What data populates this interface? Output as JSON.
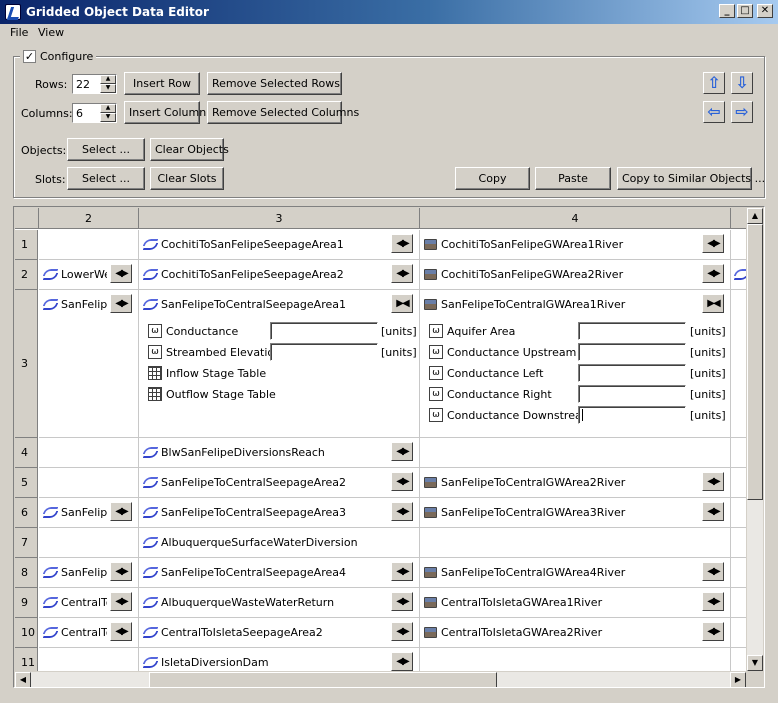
{
  "window": {
    "title": "Gridded Object Data Editor",
    "minimize": "_",
    "maximize": "□",
    "close": "✕"
  },
  "menu": [
    "File",
    "View"
  ],
  "configure": {
    "label": "Configure",
    "checked": true,
    "check_mark": "✓",
    "rows_label": "Rows:",
    "rows_value": "22",
    "columns_label": "Columns:",
    "columns_value": "6",
    "insert_row": "Insert Row",
    "remove_rows": "Remove Selected Rows",
    "insert_column": "Insert Column",
    "remove_columns": "Remove Selected Columns",
    "objects_label": "Objects:",
    "objects_select": "Select ...",
    "clear_objects": "Clear Objects",
    "slots_label": "Slots:",
    "slots_select": "Select ...",
    "clear_slots": "Clear Slots",
    "copy": "Copy",
    "paste": "Paste",
    "copy_similar": "Copy to Similar Objects ...",
    "nav_arrows": [
      "up-arrow-icon",
      "down-arrow-icon",
      "left-arrow-icon",
      "right-arrow-icon"
    ]
  },
  "grid": {
    "columns": [
      "2",
      "3",
      "4"
    ],
    "rows": [
      "1",
      "2",
      "3",
      "4",
      "5",
      "6",
      "7",
      "8",
      "9",
      "10",
      "11"
    ],
    "col2": {
      "r2": "LowerWest",
      "r3": "SanFelipe",
      "r6": "SanFelipe",
      "r8": "SanFelipe",
      "r9": "CentralTo",
      "r10": "CentralTo"
    },
    "col3": {
      "r1": "CochitiToSanFelipeSeepageArea1",
      "r2": "CochitiToSanFelipeSeepageArea2",
      "r3": "SanFelipeToCentralSeepageArea1",
      "r4": "BlwSanFelipeDiversionsReach",
      "r5": "SanFelipeToCentralSeepageArea2",
      "r6": "SanFelipeToCentralSeepageArea3",
      "r7": "AlbuquerqueSurfaceWaterDiversion",
      "r8": "SanFelipeToCentralSeepageArea4",
      "r9": "AlbuquerqueWasteWaterReturn",
      "r10": "CentralToIsletaSeepageArea2",
      "r11": "IsletaDiversionDam"
    },
    "col4": {
      "r1": "CochitiToSanFelipeGWArea1River",
      "r2": "CochitiToSanFelipeGWArea2River",
      "r3": "SanFelipeToCentralGWArea1River",
      "r5": "SanFelipeToCentralGWArea2River",
      "r6": "SanFelipeToCentralGWArea3River",
      "r8": "SanFelipeToCentralGWArea4River",
      "r9": "CentralToIsletaGWArea1River",
      "r10": "CentralToIsletaGWArea2River"
    },
    "expanded_col3": [
      {
        "label": "Conductance",
        "kind": "scalar",
        "units": "[units]"
      },
      {
        "label": "Streambed Elevation",
        "kind": "scalar",
        "units": "[units]"
      },
      {
        "label": "Inflow Stage Table",
        "kind": "table"
      },
      {
        "label": "Outflow Stage Table",
        "kind": "table"
      }
    ],
    "expanded_col4": [
      {
        "label": "Aquifer Area",
        "units": "[units]"
      },
      {
        "label": "Conductance Upstream",
        "units": "[units]"
      },
      {
        "label": "Conductance Left",
        "units": "[units]"
      },
      {
        "label": "Conductance Right",
        "units": "[units]"
      },
      {
        "label": "Conductance Downstream",
        "units": "[units]"
      }
    ],
    "omega_glyph": "ω",
    "toggle_glyph": "◀▶",
    "collapse_glyph": "▶◀"
  }
}
